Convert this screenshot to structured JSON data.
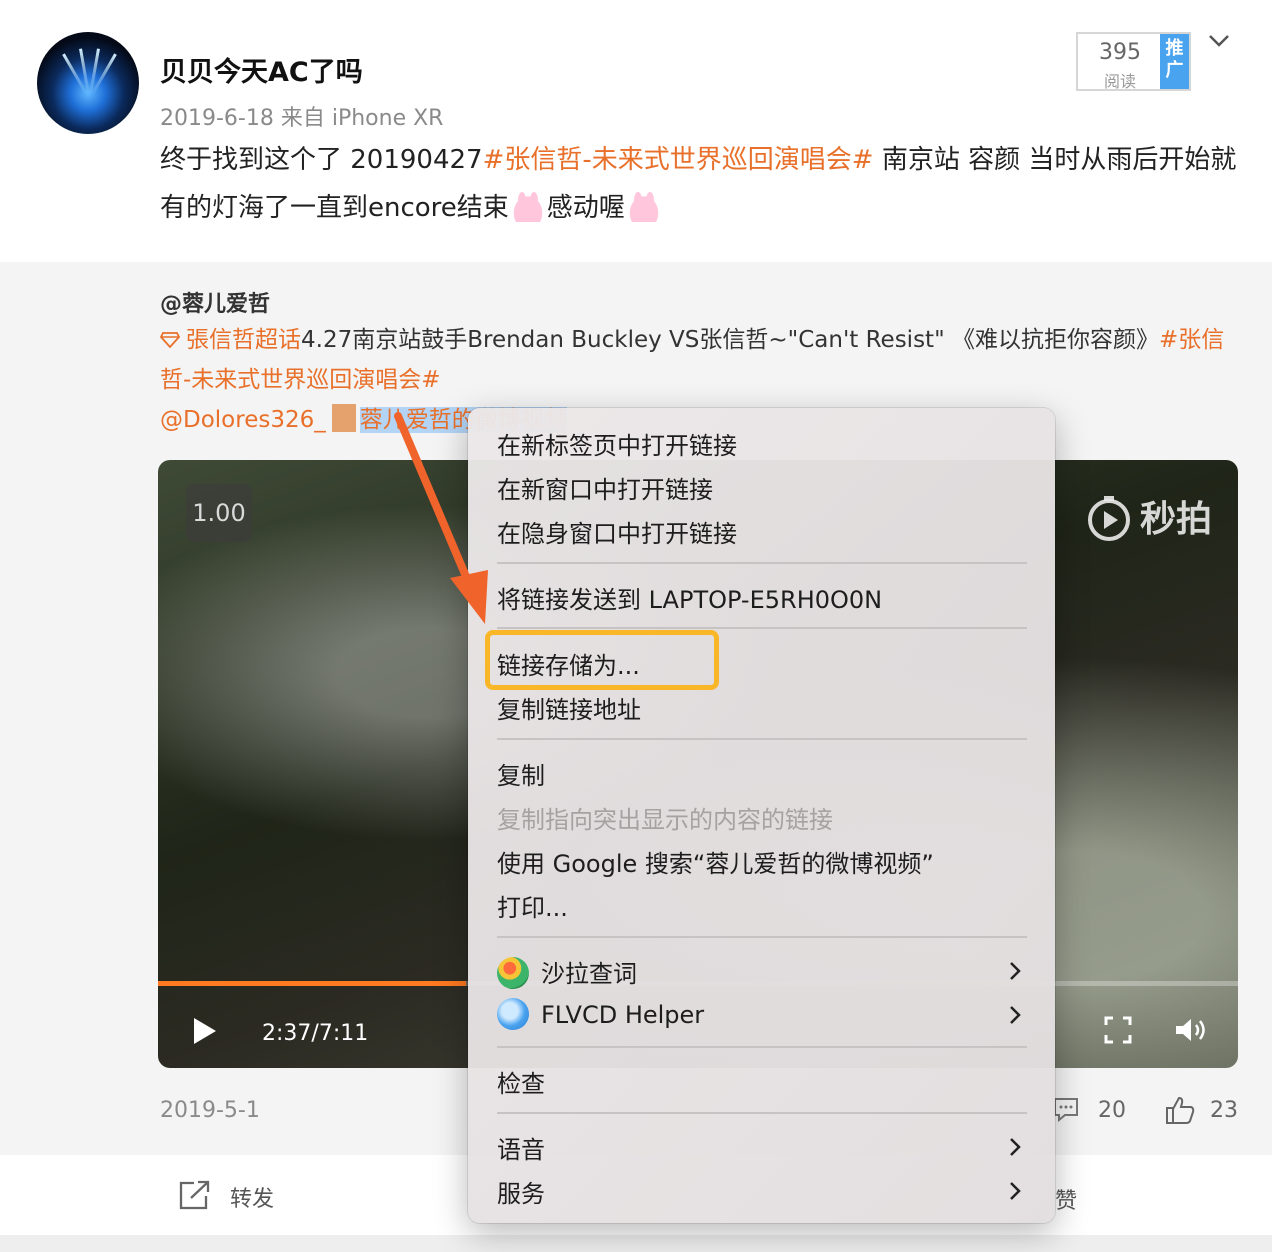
{
  "post": {
    "username": "贝贝今天AC了吗",
    "meta": "2019-6-18  来自 iPhone XR",
    "text_prefix": "终于找到这个了 20190427",
    "hashtag": "#张信哲-未来式世界巡回演唱会#",
    "text_mid": " 南京站 容颜 当时从雨后开始就有的灯海了一直到encore结束",
    "text_end": "感动喔",
    "emoji": "bunny-emoji",
    "read_count": "395",
    "read_label": "阅读",
    "promo_label": "推广"
  },
  "repost": {
    "user": "@蓉儿爱哲",
    "supertopic": "張信哲超话",
    "text": "4.27南京站鼓手Brendan Buckley VS张信哲~\"Can't Resist\" 《难以抗拒你容颜》",
    "hashtag": "#张信哲-未来式世界巡回演唱会#",
    "mention": "@Dolores326_",
    "video_link": "蓉儿爱哲的微博视频",
    "date": "2019-5-1",
    "comment_count": "20",
    "like_count": "23"
  },
  "video": {
    "speed": "1.00",
    "watermark": "秒拍",
    "time": "2:37/7:11",
    "progress": 0.285
  },
  "actions": {
    "forward": "转发",
    "like": "赞"
  },
  "context_menu": {
    "items": [
      {
        "label": "在新标签页中打开链接",
        "disabled": false
      },
      {
        "label": "在新窗口中打开链接",
        "disabled": false
      },
      {
        "label": "在隐身窗口中打开链接",
        "disabled": false
      },
      {
        "label": "将链接发送到 LAPTOP-E5RH0O0N",
        "disabled": false
      },
      {
        "label": "链接存储为...",
        "disabled": false,
        "highlighted": true
      },
      {
        "label": "复制链接地址",
        "disabled": false
      },
      {
        "label": "复制",
        "disabled": false
      },
      {
        "label": "复制指向突出显示的内容的链接",
        "disabled": true
      },
      {
        "label": "使用 Google 搜索“蓉儿爱哲的微博视频”",
        "disabled": false
      },
      {
        "label": "打印...",
        "disabled": false
      },
      {
        "label": "沙拉查词",
        "disabled": false,
        "submenu": true,
        "icon": "salad-icon"
      },
      {
        "label": "FLVCD Helper",
        "disabled": false,
        "submenu": true,
        "icon": "flvcd-icon"
      },
      {
        "label": "检查",
        "disabled": false
      },
      {
        "label": "语音",
        "disabled": false,
        "submenu": true
      },
      {
        "label": "服务",
        "disabled": false,
        "submenu": true
      }
    ]
  },
  "colors": {
    "accent": "#e8702a",
    "highlight_box": "#f9b728",
    "promo": "#4aa3ef",
    "progress": "#ff7a21"
  }
}
